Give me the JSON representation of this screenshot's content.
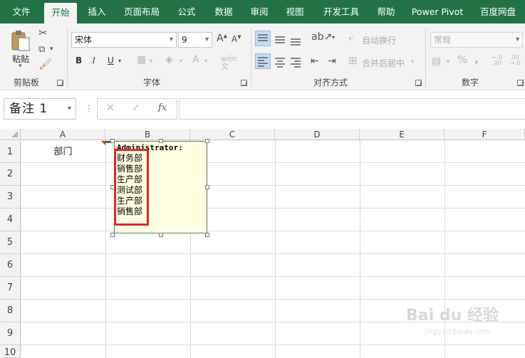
{
  "ribbon_tabs": [
    "文件",
    "开始",
    "插入",
    "页面布局",
    "公式",
    "数据",
    "审阅",
    "视图",
    "开发工具",
    "帮助",
    "Power Pivot",
    "百度网盘"
  ],
  "clipboard": {
    "paste_label": "粘贴",
    "group_label": "剪贴板"
  },
  "font": {
    "name": "宋体",
    "size": "9",
    "bold": "B",
    "italic": "I",
    "underline": "U",
    "group_label": "字体"
  },
  "alignment": {
    "wrap_text": "自动换行",
    "merge_center": "合并后居中",
    "group_label": "对齐方式"
  },
  "number": {
    "format": "常规",
    "percent": "%",
    "comma": ",",
    "group_label": "数字"
  },
  "formula_bar": {
    "name_box": "备注 1",
    "fx": "fx",
    "cancel": "✕",
    "enter": "✓"
  },
  "columns": [
    "A",
    "B",
    "C",
    "D",
    "E",
    "F"
  ],
  "rows": [
    "1",
    "2",
    "3",
    "4",
    "5",
    "6",
    "7",
    "8",
    "9",
    "10"
  ],
  "cells": {
    "A1": "部门"
  },
  "comment": {
    "author": "Administrator:",
    "lines": [
      "财务部",
      "销售部",
      "生产部",
      "测试部",
      "生产部",
      "销售部"
    ]
  },
  "watermark": {
    "brand": "Bai du 经验",
    "url": "jingyan.baidu.com"
  },
  "colors": {
    "excel_green": "#217346",
    "comment_bg": "#ffffe1",
    "highlight_red": "#e0252b"
  }
}
